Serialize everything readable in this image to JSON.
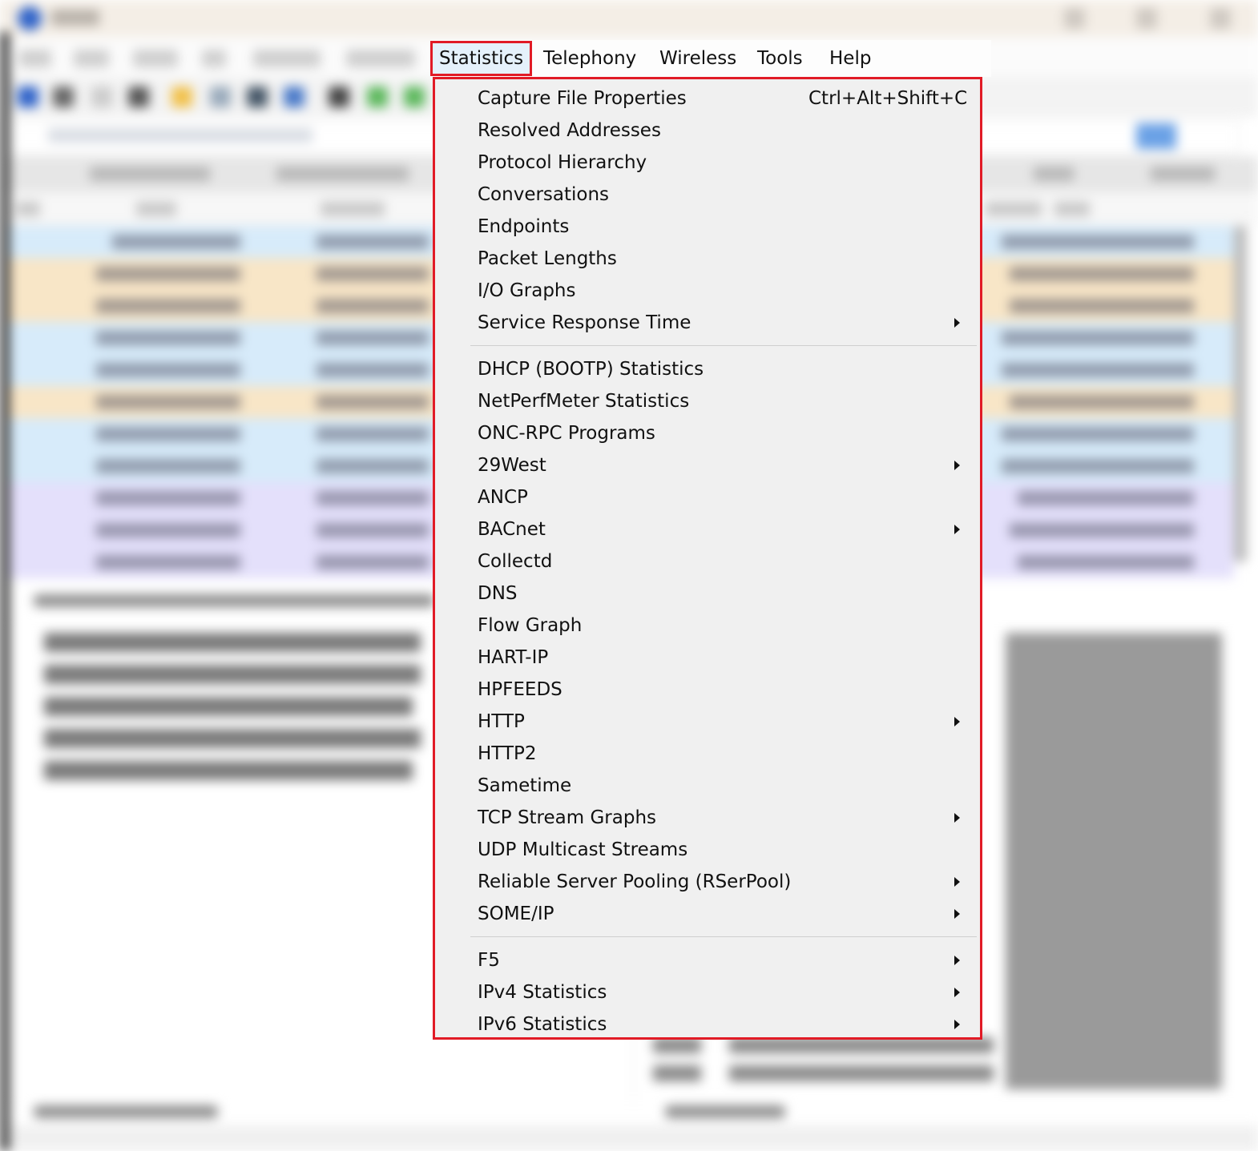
{
  "menubar": {
    "items": [
      {
        "label": "Statistics",
        "active": true
      },
      {
        "label": "Telephony"
      },
      {
        "label": "Wireless"
      },
      {
        "label": "Tools"
      },
      {
        "label": "Help"
      }
    ]
  },
  "statistics_menu": {
    "items": [
      {
        "label": "Capture File Properties",
        "shortcut": "Ctrl+Alt+Shift+C",
        "submenu": false
      },
      {
        "label": "Resolved Addresses",
        "submenu": false
      },
      {
        "label": "Protocol Hierarchy",
        "submenu": false
      },
      {
        "label": "Conversations",
        "submenu": false
      },
      {
        "label": "Endpoints",
        "submenu": false
      },
      {
        "label": "Packet Lengths",
        "submenu": false
      },
      {
        "label": "I/O Graphs",
        "submenu": false
      },
      {
        "label": "Service Response Time",
        "submenu": true
      },
      {
        "label": "DHCP (BOOTP) Statistics",
        "submenu": false
      },
      {
        "label": "NetPerfMeter Statistics",
        "submenu": false
      },
      {
        "label": "ONC-RPC Programs",
        "submenu": false
      },
      {
        "label": "29West",
        "submenu": true
      },
      {
        "label": "ANCP",
        "submenu": false
      },
      {
        "label": "BACnet",
        "submenu": true
      },
      {
        "label": "Collectd",
        "submenu": false
      },
      {
        "label": "DNS",
        "submenu": false
      },
      {
        "label": "Flow Graph",
        "submenu": false
      },
      {
        "label": "HART-IP",
        "submenu": false
      },
      {
        "label": "HPFEEDS",
        "submenu": false
      },
      {
        "label": "HTTP",
        "submenu": true
      },
      {
        "label": "HTTP2",
        "submenu": false
      },
      {
        "label": "Sametime",
        "submenu": false
      },
      {
        "label": "TCP Stream Graphs",
        "submenu": true
      },
      {
        "label": "UDP Multicast Streams",
        "submenu": false
      },
      {
        "label": "Reliable Server Pooling (RSerPool)",
        "submenu": true
      },
      {
        "label": "SOME/IP",
        "submenu": true
      },
      {
        "label": "F5",
        "submenu": true
      },
      {
        "label": "IPv4 Statistics",
        "submenu": true
      },
      {
        "label": "IPv6 Statistics",
        "submenu": true
      }
    ]
  },
  "icons": {
    "submenu_arrow": "chevron-right-icon"
  },
  "colors": {
    "highlight_border": "#e11b26",
    "menu_background": "#f0f0f0"
  }
}
